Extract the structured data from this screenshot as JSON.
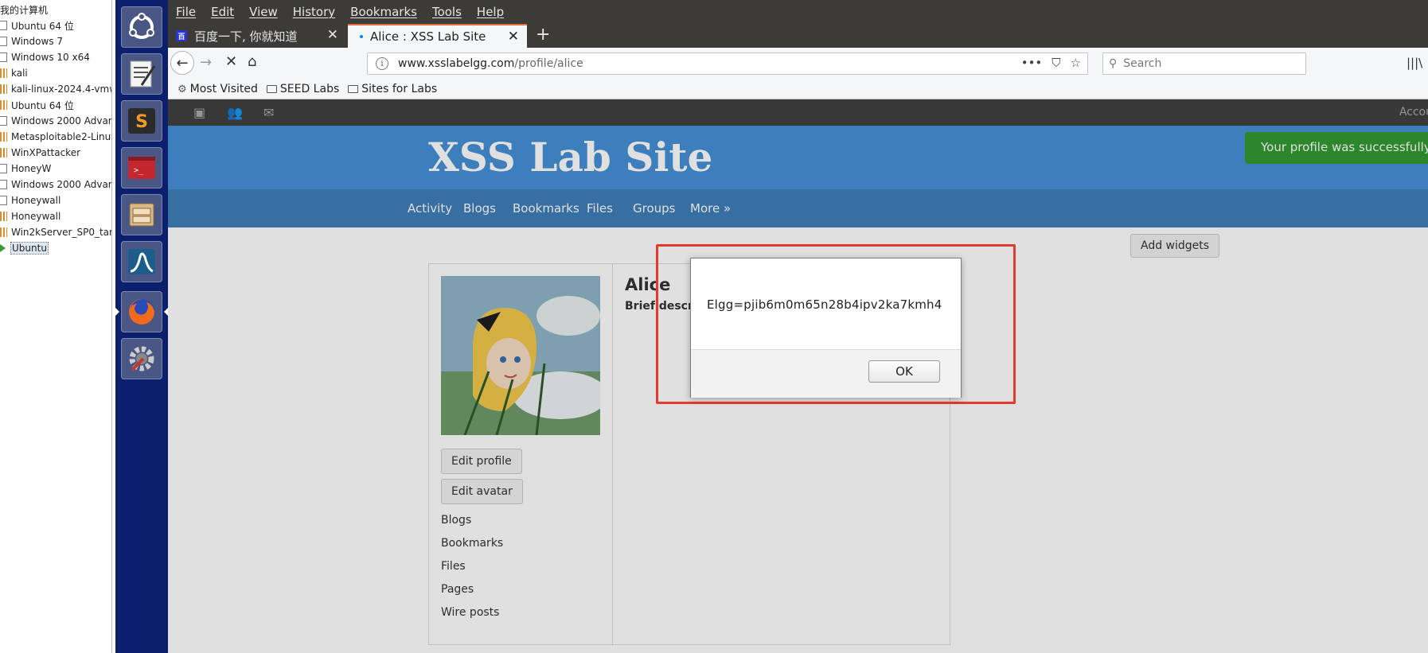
{
  "vm_library": {
    "title": "我的计算机",
    "items": [
      {
        "label": "Ubuntu 64 位",
        "icon": "vm-file-icon"
      },
      {
        "label": "Windows 7",
        "icon": "vm-file-icon"
      },
      {
        "label": "Windows 10 x64",
        "icon": "vm-file-icon"
      },
      {
        "label": "kali",
        "icon": "vm-suspended-icon"
      },
      {
        "label": "kali-linux-2024.4-vmw",
        "icon": "vm-suspended-icon"
      },
      {
        "label": "Ubuntu 64 位",
        "icon": "vm-suspended-icon"
      },
      {
        "label": "Windows 2000 Advan",
        "icon": "vm-file-icon"
      },
      {
        "label": "Metasploitable2-Linux",
        "icon": "vm-suspended-icon"
      },
      {
        "label": "WinXPattacker",
        "icon": "vm-suspended-icon"
      },
      {
        "label": "HoneyW",
        "icon": "vm-file-icon"
      },
      {
        "label": "Windows 2000 Advan",
        "icon": "vm-file-icon"
      },
      {
        "label": "Honeywall",
        "icon": "vm-file-icon"
      },
      {
        "label": "Honeywall",
        "icon": "vm-suspended-icon"
      },
      {
        "label": "Win2kServer_SP0_targ",
        "icon": "vm-suspended-icon"
      },
      {
        "label": "Ubuntu",
        "icon": "vm-running-icon",
        "selected": true
      }
    ]
  },
  "launcher": {
    "items": [
      "ubuntu-dash-icon",
      "text-editor-icon",
      "sublime-text-icon",
      "terminal-icon",
      "file-manager-icon",
      "wireshark-icon",
      "firefox-icon",
      "system-settings-icon"
    ]
  },
  "firefox": {
    "menu": [
      "File",
      "Edit",
      "View",
      "History",
      "Bookmarks",
      "Tools",
      "Help"
    ],
    "tabs": [
      {
        "title": "百度一下, 你就知道",
        "active": false
      },
      {
        "title": "Alice : XSS Lab Site",
        "active": true
      }
    ],
    "url_host": "www.xsslabelgg.com",
    "url_path": "/profile/alice",
    "search_placeholder": "Search",
    "bookmarks": [
      "Most Visited",
      "SEED Labs",
      "Sites for Labs"
    ]
  },
  "site": {
    "topbar_account": "Accou",
    "title": "XSS Lab Site",
    "success_message": "Your profile was successfully saved.",
    "nav": [
      "Activity",
      "Blogs",
      "Bookmarks",
      "Files",
      "Groups",
      "More »"
    ],
    "add_widgets": "Add widgets",
    "profile": {
      "name": "Alice",
      "brief_label": "Brief description:",
      "buttons": [
        "Edit profile",
        "Edit avatar"
      ],
      "links": [
        "Blogs",
        "Bookmarks",
        "Files",
        "Pages",
        "Wire posts"
      ]
    }
  },
  "alert": {
    "message": "Elgg=pjib6m0m65n28b4ipv2ka7kmh4",
    "ok_label": "OK"
  }
}
